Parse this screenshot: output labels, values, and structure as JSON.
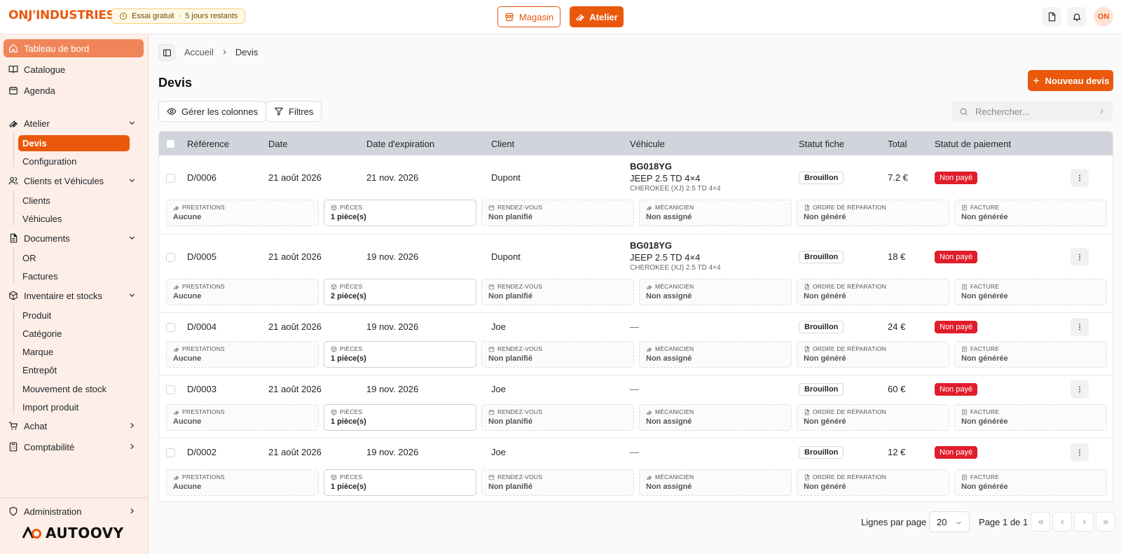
{
  "topbar": {
    "brand": "ONJ'INDUSTRIES",
    "trial_label": "Essai gratuit",
    "trial_sep": "·",
    "trial_days": "5 jours restants",
    "magasin_label": "Magasin",
    "atelier_label": "Atelier",
    "avatar_initials": "ON"
  },
  "sidebar": {
    "items": [
      {
        "label": "Tableau de bord",
        "icon": "home-icon"
      },
      {
        "label": "Catalogue",
        "icon": "book-icon"
      },
      {
        "label": "Agenda",
        "icon": "calendar-icon"
      },
      {
        "label": "Atelier",
        "icon": "wrench-icon"
      },
      {
        "label": "Clients et Véhicules",
        "icon": "users-icon"
      },
      {
        "label": "Documents",
        "icon": "document-icon"
      },
      {
        "label": "Inventaire et stocks",
        "icon": "package-icon"
      },
      {
        "label": "Achat",
        "icon": "cart-icon"
      },
      {
        "label": "Comptabilité",
        "icon": "calculator-icon"
      },
      {
        "label": "Administration",
        "icon": "shield-icon"
      }
    ],
    "atelier_sub": [
      "Devis",
      "Configuration"
    ],
    "clients_sub": [
      "Clients",
      "Véhicules"
    ],
    "documents_sub": [
      "OR",
      "Factures"
    ],
    "inventaire_sub": [
      "Produit",
      "Catégorie",
      "Marque",
      "Entrepôt",
      "Mouvement de stock",
      "Import produit"
    ],
    "logo_text": "AUTOOVY"
  },
  "breadcrumb": {
    "home": "Accueil",
    "current": "Devis"
  },
  "page": {
    "title": "Devis",
    "new_button": "Nouveau devis",
    "columns_button": "Gérer les colonnes",
    "filters_button": "Filtres",
    "search_placeholder": "Rechercher..."
  },
  "table": {
    "headers": [
      "Référence",
      "Date",
      "Date d'expiration",
      "Client",
      "Véhicule",
      "Statut fiche",
      "Total",
      "Statut de paiement"
    ],
    "detail_labels": [
      "PRESTATIONS",
      "PIÈCES",
      "RENDEZ-VOUS",
      "MÉCANICIEN",
      "ORDRE DE RÉPARATION",
      "FACTURE"
    ],
    "rows": [
      {
        "ref": "D/0006",
        "date": "21 août 2026",
        "expiry": "21 nov. 2026",
        "client": "Dupont",
        "plate": "BG018YG",
        "model": "JEEP 2.5 TD 4×4",
        "sub": "CHEROKEE (XJ) 2.5 TD 4×4",
        "vehicle_empty": "",
        "status": "Brouillon",
        "total": "7.2 €",
        "payment": "Non payé",
        "details": [
          "Aucune",
          "1 pièce(s)",
          "Non planifié",
          "Non assigné",
          "Non généré",
          "Non générée"
        ]
      },
      {
        "ref": "D/0005",
        "date": "21 août 2026",
        "expiry": "19 nov. 2026",
        "client": "Dupont",
        "plate": "BG018YG",
        "model": "JEEP 2.5 TD 4×4",
        "sub": "CHEROKEE (XJ) 2.5 TD 4×4",
        "vehicle_empty": "",
        "status": "Brouillon",
        "total": "18 €",
        "payment": "Non payé",
        "details": [
          "Aucune",
          "2 pièce(s)",
          "Non planifié",
          "Non assigné",
          "Non généré",
          "Non générée"
        ]
      },
      {
        "ref": "D/0004",
        "date": "21 août 2026",
        "expiry": "19 nov. 2026",
        "client": "Joe",
        "plate": "",
        "model": "",
        "sub": "",
        "vehicle_empty": "—",
        "status": "Brouillon",
        "total": "24 €",
        "payment": "Non payé",
        "details": [
          "Aucune",
          "1 pièce(s)",
          "Non planifié",
          "Non assigné",
          "Non généré",
          "Non générée"
        ]
      },
      {
        "ref": "D/0003",
        "date": "21 août 2026",
        "expiry": "19 nov. 2026",
        "client": "Joe",
        "plate": "",
        "model": "",
        "sub": "",
        "vehicle_empty": "—",
        "status": "Brouillon",
        "total": "60 €",
        "payment": "Non payé",
        "details": [
          "Aucune",
          "1 pièce(s)",
          "Non planifié",
          "Non assigné",
          "Non généré",
          "Non générée"
        ]
      },
      {
        "ref": "D/0002",
        "date": "21 août 2026",
        "expiry": "19 nov. 2026",
        "client": "Joe",
        "plate": "",
        "model": "",
        "sub": "",
        "vehicle_empty": "—",
        "status": "Brouillon",
        "total": "12 €",
        "payment": "Non payé",
        "details": [
          "Aucune",
          "1 pièce(s)",
          "Non planifié",
          "Non assigné",
          "Non généré",
          "Non générée"
        ]
      }
    ]
  },
  "pagination": {
    "rows_label": "Lignes par page",
    "rows_value": "20",
    "page_label": "Page 1 de 1"
  },
  "colors": {
    "accent": "#ea580c",
    "sidebar_bg": "#fdeee7",
    "danger": "#e11d2a"
  }
}
